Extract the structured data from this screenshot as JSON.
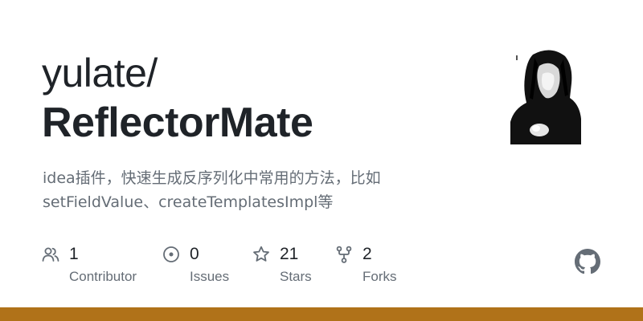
{
  "repo": {
    "owner": "yulate/",
    "name": "ReflectorMate",
    "description_line1": "idea插件，快速生成反序列化中常用的方法，比如",
    "description_line2": "setFieldValue、createTemplatesImpl等"
  },
  "stats": [
    {
      "icon": "people-icon",
      "count": "1",
      "label": "Contributor"
    },
    {
      "icon": "issue-icon",
      "count": "0",
      "label": "Issues"
    },
    {
      "icon": "star-icon",
      "count": "21",
      "label": "Stars"
    },
    {
      "icon": "fork-icon",
      "count": "2",
      "label": "Forks"
    }
  ],
  "icons": {
    "brand": "github-mark-icon",
    "avatar": "owner-avatar"
  },
  "colors": {
    "text_primary": "#1f2328",
    "text_secondary": "#656d76",
    "language_bar": "#b07219"
  }
}
